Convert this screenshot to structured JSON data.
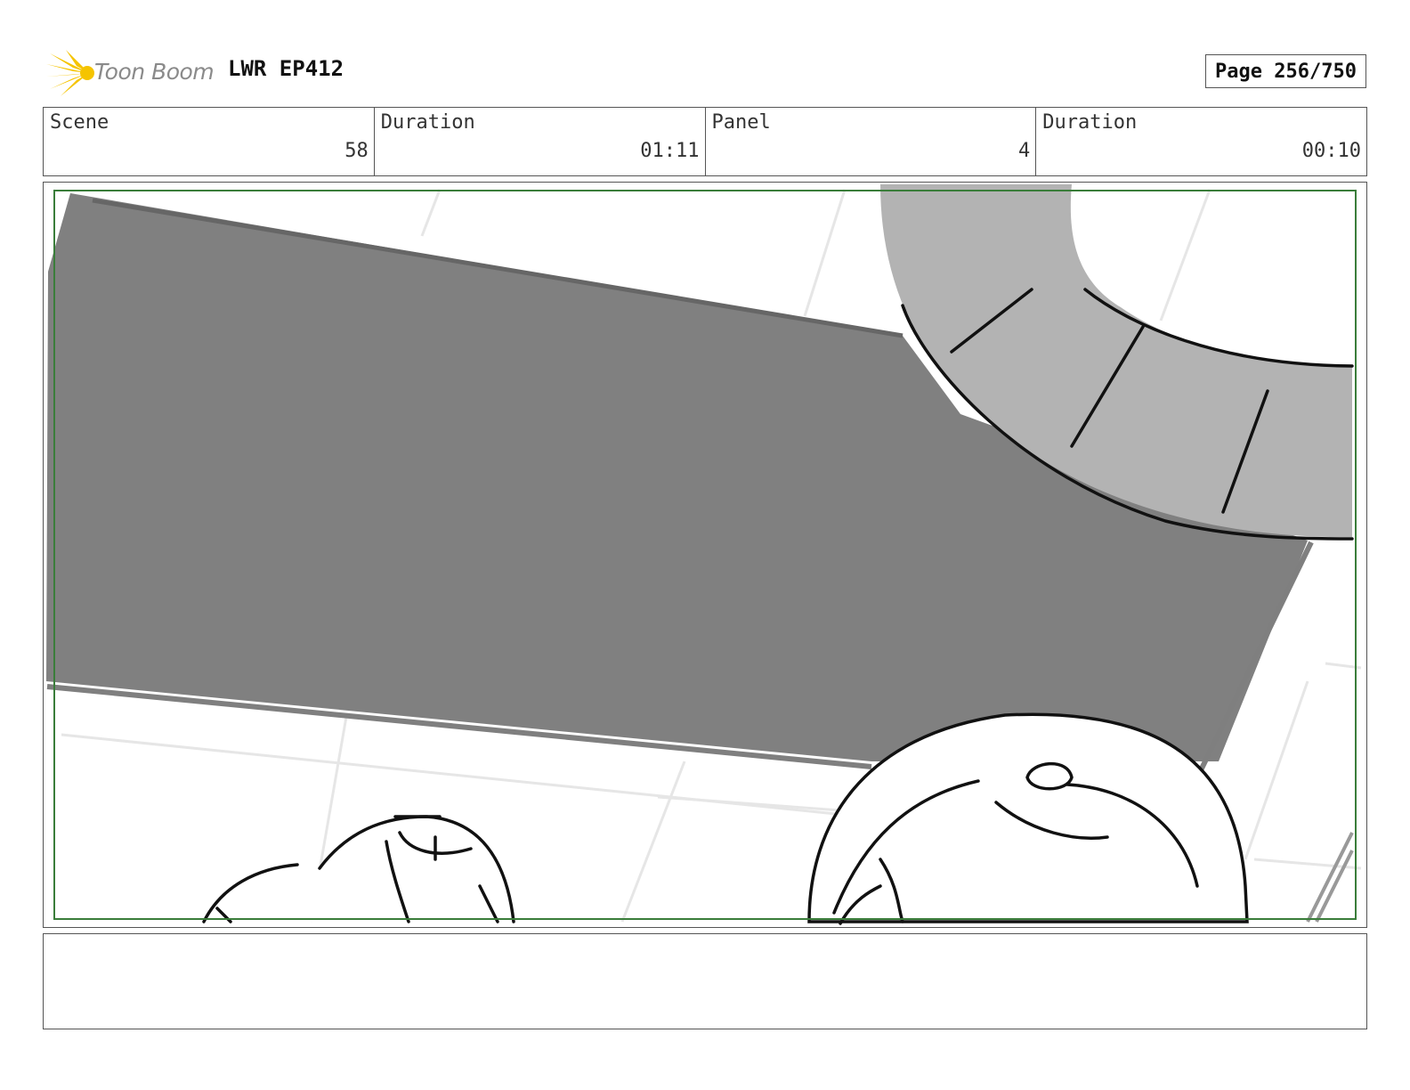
{
  "header": {
    "logo_text": "Toon Boom",
    "project_title": "LWR EP412",
    "page_label": "Page 256/750"
  },
  "info": {
    "scene_label": "Scene",
    "scene_value": "58",
    "scene_duration_label": "Duration",
    "scene_duration_value": "01:11",
    "panel_label": "Panel",
    "panel_value": "4",
    "panel_duration_label": "Duration",
    "panel_duration_value": "00:10"
  },
  "colors": {
    "safe_frame": "#3a7d3a",
    "dark_tone": "#808080",
    "light_tone": "#b3b3b3",
    "logo_yellow": "#f5c400"
  }
}
